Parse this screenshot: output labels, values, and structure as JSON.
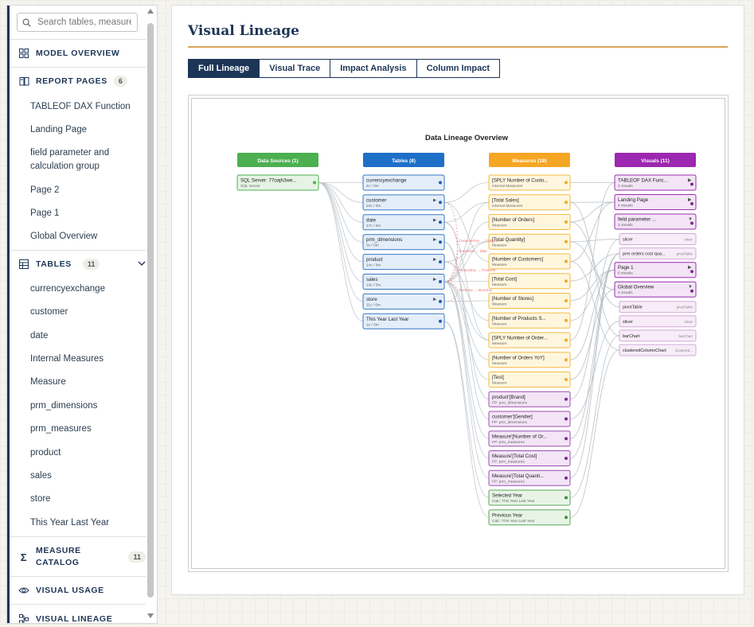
{
  "sidebar": {
    "search_placeholder": "Search tables, measures",
    "sections": {
      "model_overview": "MODEL OVERVIEW",
      "report_pages": "REPORT PAGES",
      "report_pages_count": "6",
      "tables": "TABLES",
      "tables_count": "11",
      "measure_catalog_line1": "MEASURE",
      "measure_catalog_line2": "CATALOG",
      "measure_catalog_count": "11",
      "visual_usage": "VISUAL USAGE",
      "visual_lineage": "VISUAL LINEAGE"
    },
    "pages": [
      "TABLEOF DAX Function",
      "Landing Page",
      "field parameter and calculation group",
      "Page 2",
      "Page 1",
      "Global Overview"
    ],
    "tables": [
      "currencyexchange",
      "customer",
      "date",
      "Internal Measures",
      "Measure",
      "prm_dimensions",
      "prm_measures",
      "product",
      "sales",
      "store",
      "This Year Last Year"
    ]
  },
  "main": {
    "title": "Visual Lineage",
    "tabs": [
      "Full Lineage",
      "Visual Trace",
      "Impact Analysis",
      "Column Impact"
    ],
    "active_tab": "Full Lineage"
  },
  "diagram": {
    "title": "Data Lineage Overview",
    "columns": [
      {
        "label": "Data Sources (1)",
        "color": "#4caf50"
      },
      {
        "label": "Tables (8)",
        "color": "#1e6fc8"
      },
      {
        "label": "Measures (18)",
        "color": "#f5a623"
      },
      {
        "label": "Visuals (11)",
        "color": "#9c27b0"
      }
    ],
    "sources": [
      {
        "name": "SQL Server: 77oajh3we...",
        "sub": "SQL Server"
      }
    ],
    "tables": [
      {
        "name": "currencyexchange",
        "sub": "4c / 0m"
      },
      {
        "name": "customer",
        "sub": "24c / 0m"
      },
      {
        "name": "date",
        "sub": "17c / 0m"
      },
      {
        "name": "prm_dimensions",
        "sub": "3c / 0m"
      },
      {
        "name": "product",
        "sub": "14c / 0m"
      },
      {
        "name": "sales",
        "sub": "13c / 0m"
      },
      {
        "name": "store",
        "sub": "11c / 0m"
      },
      {
        "name": "This Year Last Year",
        "sub": "2c / 0m"
      }
    ],
    "measures": [
      {
        "name": "[SPLY Number of Custo...",
        "sub": "Internal Measures",
        "kind": "m"
      },
      {
        "name": "[Total Sales]",
        "sub": "Internal Measures",
        "kind": "m"
      },
      {
        "name": "[Number of Orders]",
        "sub": "Measure",
        "kind": "m"
      },
      {
        "name": "[Total Quantity]",
        "sub": "Measure",
        "kind": "m"
      },
      {
        "name": "[Number of Customers]",
        "sub": "Measure",
        "kind": "m"
      },
      {
        "name": "[Total Cost]",
        "sub": "Measure",
        "kind": "m"
      },
      {
        "name": "[Number of Stores]",
        "sub": "Measure",
        "kind": "m"
      },
      {
        "name": "[Number of Products S...",
        "sub": "Measure",
        "kind": "m"
      },
      {
        "name": "[SPLY Number of Order...",
        "sub": "Measure",
        "kind": "m"
      },
      {
        "name": "[Number of Orders YoY]",
        "sub": "Measure",
        "kind": "m"
      },
      {
        "name": "[Test]",
        "sub": "Measure",
        "kind": "m"
      },
      {
        "name": "product'[Brand]",
        "sub": "FP: prm_dimensions",
        "kind": "fp"
      },
      {
        "name": "customer'[Gender]",
        "sub": "FP: prm_dimensions",
        "kind": "fp"
      },
      {
        "name": "Measure'[Number of Or...",
        "sub": "FP: prm_measures",
        "kind": "fp"
      },
      {
        "name": "Measure'[Total Cost]",
        "sub": "FP: prm_measures",
        "kind": "fp"
      },
      {
        "name": "Measure'[Total Quanti...",
        "sub": "FP: prm_measures",
        "kind": "fp"
      },
      {
        "name": "Selected Year",
        "sub": "Calc: This Year Last Year",
        "kind": "calc"
      },
      {
        "name": "Previous Year",
        "sub": "Calc: This Year Last Year",
        "kind": "calc"
      }
    ],
    "visuals": [
      {
        "name": "TABLEOF DAX Func...",
        "sub": "2 visuals",
        "kind": "page",
        "arrow": "▶"
      },
      {
        "name": "Landing Page",
        "sub": "4 visuals",
        "kind": "page",
        "arrow": "▶"
      },
      {
        "name": "field parameter ...",
        "sub": "2 visuals",
        "kind": "page",
        "arrow": "▼"
      },
      {
        "name": "slicer",
        "type": "slicer",
        "kind": "child"
      },
      {
        "name": "prm orders cost qua...",
        "type": "pivotTable",
        "kind": "child"
      },
      {
        "name": "Page 1",
        "sub": "6 visuals",
        "kind": "page",
        "arrow": "▶"
      },
      {
        "name": "Global Overview",
        "sub": "4 visuals",
        "kind": "page",
        "arrow": "▼"
      },
      {
        "name": "pivotTable",
        "type": "pivotTable",
        "kind": "child"
      },
      {
        "name": "slicer",
        "type": "slicer",
        "kind": "child"
      },
      {
        "name": "barChart",
        "type": "barChart",
        "kind": "child"
      },
      {
        "name": "clusteredColumnChart",
        "type": "clustered...",
        "kind": "child"
      }
    ],
    "relationships": [
      {
        "label": "CustomerKey → Custom..."
      },
      {
        "label": "OrderDate → Date"
      },
      {
        "label": "ProductKey → ProductK..."
      },
      {
        "label": "StoreKey → StoreKey"
      }
    ]
  }
}
